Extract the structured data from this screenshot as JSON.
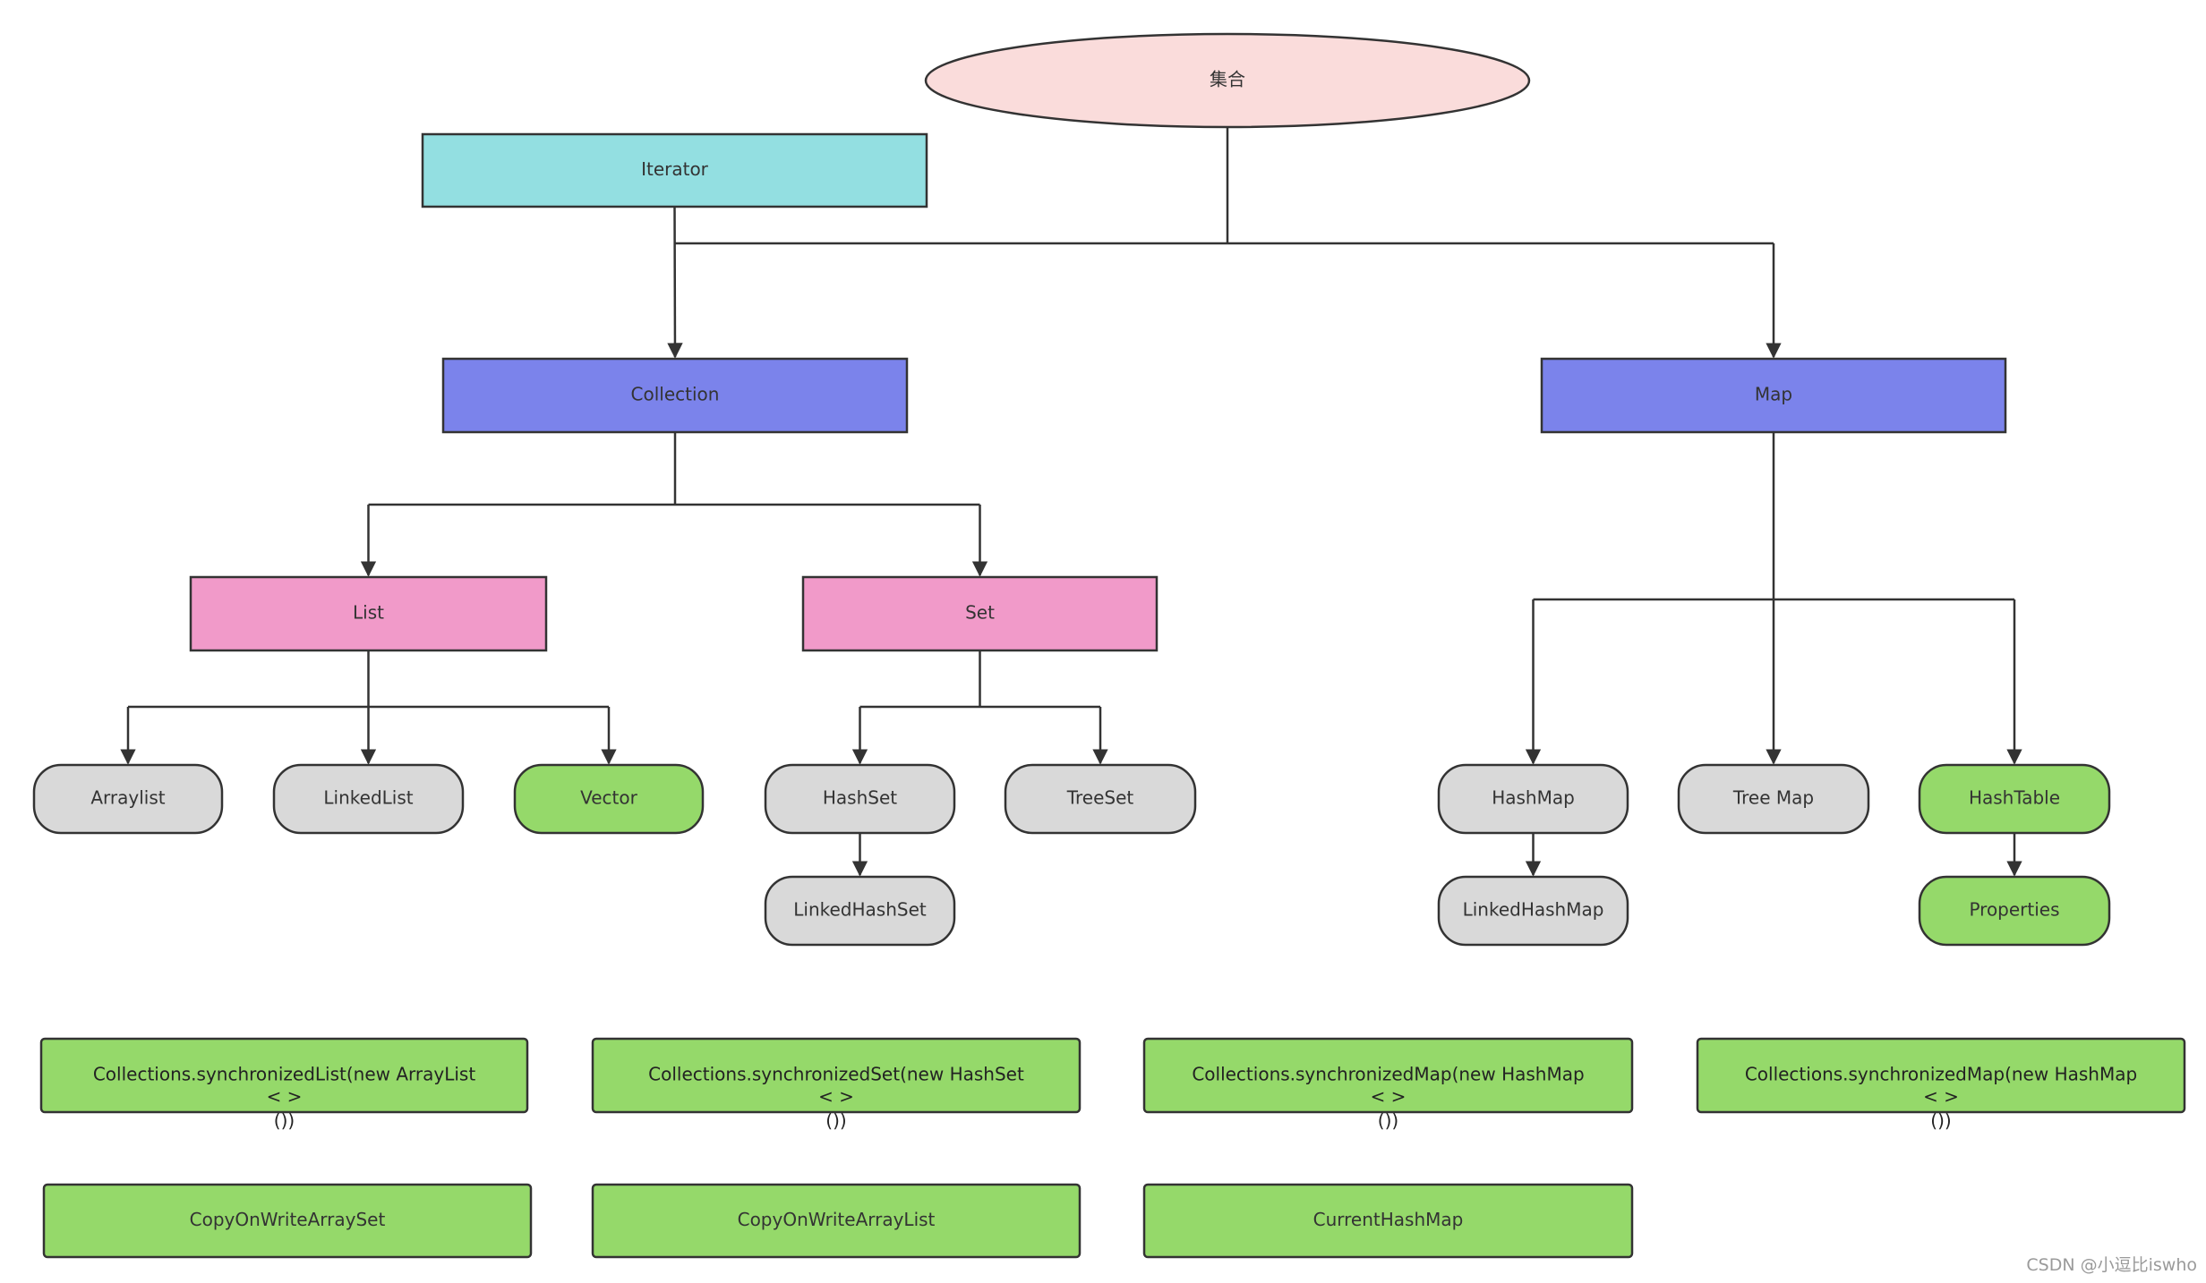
{
  "diagram": {
    "root": {
      "id": "root",
      "label": "集合",
      "shape": "ellipse",
      "color": "#fadcdb"
    },
    "nodes": [
      {
        "id": "iterator",
        "label": "Iterator",
        "shape": "rect",
        "color": "#93dfe1"
      },
      {
        "id": "collection",
        "label": "Collection",
        "shape": "rect",
        "color": "#7b83eb"
      },
      {
        "id": "map",
        "label": "Map",
        "shape": "rect",
        "color": "#7b83eb"
      },
      {
        "id": "list",
        "label": "List",
        "shape": "rect",
        "color": "#f19ac9"
      },
      {
        "id": "set",
        "label": "Set",
        "shape": "rect",
        "color": "#f19ac9"
      },
      {
        "id": "arraylist",
        "label": "Arraylist",
        "shape": "pill",
        "color": "#d9d9d9"
      },
      {
        "id": "linkedlist",
        "label": "LinkedList",
        "shape": "pill",
        "color": "#d9d9d9"
      },
      {
        "id": "vector",
        "label": "Vector",
        "shape": "pill",
        "color": "#95d96a"
      },
      {
        "id": "hashset",
        "label": "HashSet",
        "shape": "pill",
        "color": "#d9d9d9"
      },
      {
        "id": "treeset",
        "label": "TreeSet",
        "shape": "pill",
        "color": "#d9d9d9"
      },
      {
        "id": "linkedhashset",
        "label": "LinkedHashSet",
        "shape": "pill",
        "color": "#d9d9d9"
      },
      {
        "id": "hashmap",
        "label": "HashMap",
        "shape": "pill",
        "color": "#d9d9d9"
      },
      {
        "id": "treemap",
        "label": "Tree Map",
        "shape": "pill",
        "color": "#d9d9d9"
      },
      {
        "id": "hashtable",
        "label": "HashTable",
        "shape": "pill",
        "color": "#95d96a"
      },
      {
        "id": "linkedhashmap",
        "label": "LinkedHashMap",
        "shape": "pill",
        "color": "#d9d9d9"
      },
      {
        "id": "properties",
        "label": "Properties",
        "shape": "pill",
        "color": "#95d96a"
      }
    ],
    "edges": [
      {
        "from": "root",
        "to": "collection"
      },
      {
        "from": "root",
        "to": "map"
      },
      {
        "from": "iterator",
        "to": "collection"
      },
      {
        "from": "collection",
        "to": "list"
      },
      {
        "from": "collection",
        "to": "set"
      },
      {
        "from": "list",
        "to": "arraylist"
      },
      {
        "from": "list",
        "to": "linkedlist"
      },
      {
        "from": "list",
        "to": "vector"
      },
      {
        "from": "set",
        "to": "hashset"
      },
      {
        "from": "set",
        "to": "treeset"
      },
      {
        "from": "hashset",
        "to": "linkedhashset"
      },
      {
        "from": "map",
        "to": "hashmap"
      },
      {
        "from": "map",
        "to": "treemap"
      },
      {
        "from": "map",
        "to": "hashtable"
      },
      {
        "from": "hashmap",
        "to": "linkedhashmap"
      },
      {
        "from": "hashtable",
        "to": "properties"
      }
    ],
    "thread_safe_wrappers": [
      {
        "id": "sync-list",
        "lines": [
          "Collections.synchronizedList(new ArrayList",
          "< >",
          "())"
        ],
        "color": "#95d96a"
      },
      {
        "id": "sync-set",
        "lines": [
          "Collections.synchronizedSet(new HashSet",
          "< >",
          "())"
        ],
        "color": "#95d96a"
      },
      {
        "id": "sync-map-1",
        "lines": [
          "Collections.synchronizedMap(new HashMap",
          "< >",
          "())"
        ],
        "color": "#95d96a"
      },
      {
        "id": "sync-map-2",
        "lines": [
          "Collections.synchronizedMap(new HashMap",
          "< >",
          "())"
        ],
        "color": "#95d96a"
      }
    ],
    "concurrent_classes": [
      {
        "id": "cow-set",
        "label": "CopyOnWriteArraySet",
        "color": "#95d96a"
      },
      {
        "id": "cow-list",
        "label": "CopyOnWriteArrayList",
        "color": "#95d96a"
      },
      {
        "id": "current-hashmap",
        "label": "CurrentHashMap",
        "color": "#95d96a"
      }
    ],
    "line_color": "#333333"
  },
  "watermark": "CSDN @小逗比iswho"
}
